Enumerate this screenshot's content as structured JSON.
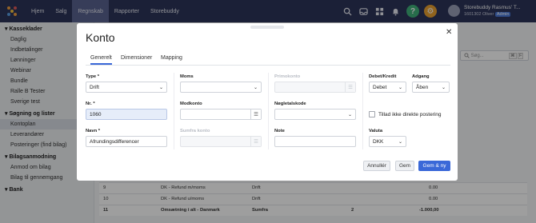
{
  "app": {
    "nav": [
      "Hjem",
      "Salg",
      "Regnskab",
      "Rapporter",
      "Storebuddy"
    ],
    "active_nav": "Regnskab",
    "user": {
      "name": "Storebuddy Rasmus' T...",
      "id_line": "1601302 Oliver",
      "badge": "Admin"
    },
    "icons": [
      "search-icon",
      "inbox-icon",
      "apps-icon",
      "bell-icon",
      "help-icon",
      "gear-icon"
    ]
  },
  "sidebar": {
    "sections": [
      {
        "title": "Kasseklader",
        "items": [
          "Daglig",
          "Indbetalinger",
          "Lønninger",
          "Webinar",
          "Bundle",
          "Ralle B Tester",
          "Sverige test"
        ]
      },
      {
        "title": "Søgning og lister",
        "items": [
          "Kontoplan",
          "Leverandører",
          "Posteringer (find bilag)"
        ]
      },
      {
        "title": "Bilagsanmodning",
        "items": [
          "Anmod om bilag",
          "Bilag til gennemgang"
        ]
      },
      {
        "title": "Bank",
        "items": []
      }
    ],
    "selected": "Kontoplan"
  },
  "background_list": {
    "search_placeholder": "Søg...",
    "shortcut_1": "⌘",
    "shortcut_2": "F",
    "rows": [
      {
        "nr": "9",
        "name": "DK - Refund m/moms",
        "type": "Drift",
        "count": "",
        "amount": "0.00"
      },
      {
        "nr": "10",
        "name": "DK - Refund u/moms",
        "type": "Drift",
        "count": "",
        "amount": "0.00"
      },
      {
        "nr": "11",
        "name": "Omsætning i alt - Danmark",
        "type": "Sumfra",
        "count": "2",
        "amount": "-1.000,00"
      }
    ]
  },
  "modal": {
    "title": "Konto",
    "tabs": [
      "Generelt",
      "Dimensioner",
      "Mapping"
    ],
    "active_tab": "Generelt",
    "type_label": "Type *",
    "type_value": "Drift",
    "nr_label": "Nr. *",
    "nr_value": "1060",
    "navn_label": "Navn *",
    "navn_value": "Afrundingsdifferencer",
    "moms_label": "Moms",
    "moms_value": "",
    "modkonto_label": "Modkonto",
    "sumfra_label": "Sumfra konto",
    "primokonto_label": "Primokonto",
    "noegletal_label": "Nøgletalskode",
    "note_label": "Note",
    "debet_label": "Debet/Kredit",
    "debet_value": "Debet",
    "adgang_label": "Adgang",
    "adgang_value": "Åben",
    "direct_posting_label": "Tillad ikke direkte postering",
    "valuta_label": "Valuta",
    "valuta_value": "DKK",
    "cancel_label": "Annullér",
    "save_label": "Gem",
    "save_new_label": "Gem & ny"
  }
}
